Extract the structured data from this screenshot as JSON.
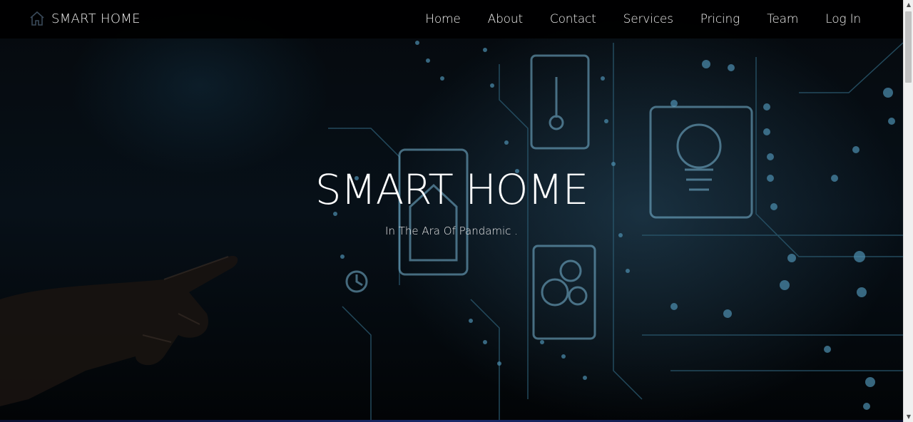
{
  "brand": {
    "name": "SMART HOME",
    "icon": "home-icon"
  },
  "nav": {
    "items": [
      {
        "label": "Home"
      },
      {
        "label": "About"
      },
      {
        "label": "Contact"
      },
      {
        "label": "Services"
      },
      {
        "label": "Pricing"
      },
      {
        "label": "Team"
      },
      {
        "label": "Log In"
      }
    ]
  },
  "hero": {
    "title": "SMART HOME",
    "subtitle": "In The Ara Of Pandamic ."
  },
  "colors": {
    "navbar_bg": "#000000",
    "text": "#ffffff",
    "circuit_accent": "#6fb0d0"
  }
}
